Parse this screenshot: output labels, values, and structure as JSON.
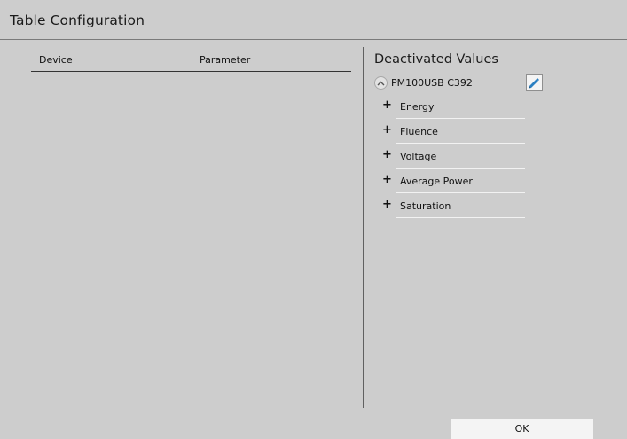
{
  "window": {
    "title": "Table Configuration"
  },
  "table": {
    "columns": [
      "Device",
      "Parameter"
    ],
    "rows": []
  },
  "deactivated": {
    "title": "Deactivated Values",
    "device": "PM100USB C392",
    "items": [
      {
        "label": "Energy"
      },
      {
        "label": "Fluence"
      },
      {
        "label": "Voltage"
      },
      {
        "label": "Average Power"
      },
      {
        "label": "Saturation"
      }
    ],
    "expand_symbol": "+"
  },
  "footer": {
    "ok_label": "OK"
  },
  "colors": {
    "background": "#cdcdcd",
    "divider": "#606060",
    "button_face": "#f4f4f4",
    "edit_icon": "#2a7fc1"
  },
  "icons": {
    "collapse": "chevron-up-icon",
    "edit": "pencil-icon"
  }
}
